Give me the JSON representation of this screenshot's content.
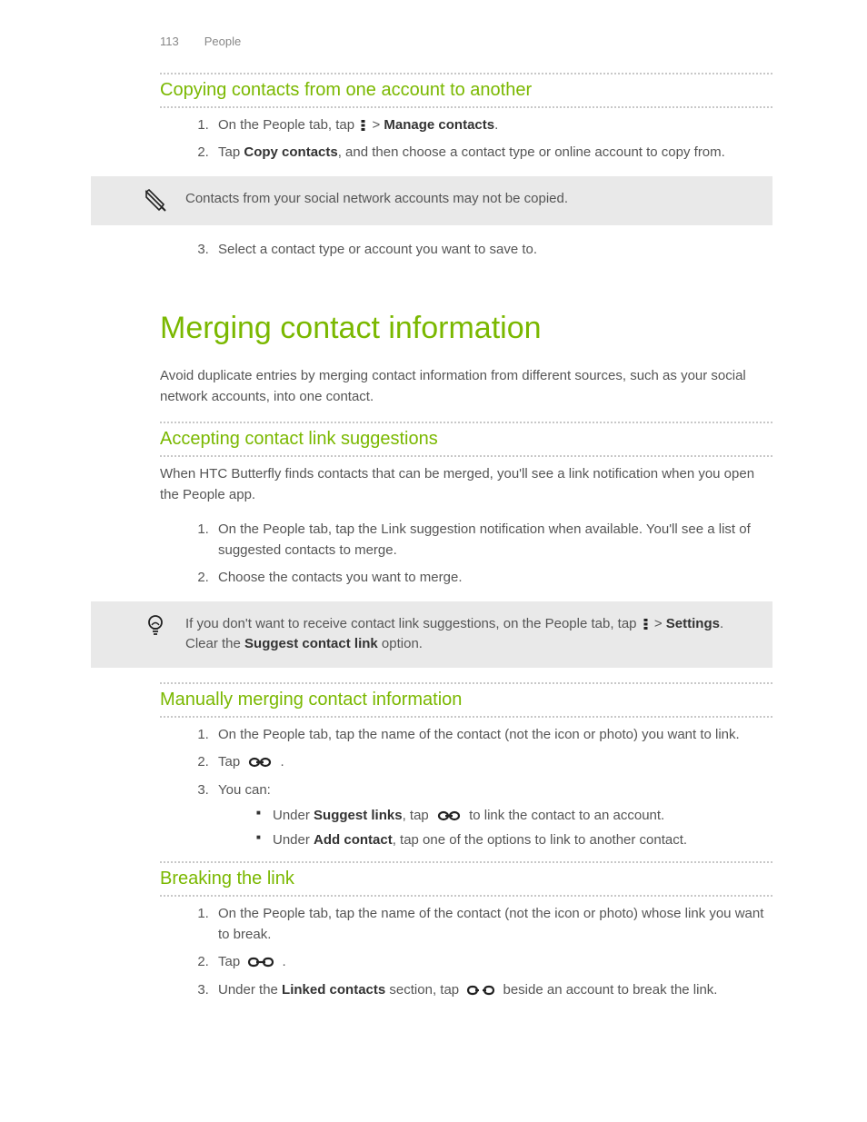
{
  "header": {
    "page_number": "113",
    "section": "People"
  },
  "copy_section": {
    "heading": "Copying contacts from one account to another",
    "step1_before": "On the People tab, tap ",
    "step1_after": " > ",
    "step1_bold": "Manage contacts",
    "step1_end": ".",
    "step2_before": "Tap ",
    "step2_bold": "Copy contacts",
    "step2_after": ", and then choose a contact type or online account to copy from.",
    "note": "Contacts from your social network accounts may not be copied.",
    "step3": "Select a contact type or account you want to save to."
  },
  "merge_section": {
    "heading": "Merging contact information",
    "intro": "Avoid duplicate entries by merging contact information from different sources, such as your social network accounts, into one contact."
  },
  "accept_section": {
    "heading": "Accepting contact link suggestions",
    "intro": "When HTC Butterfly finds contacts that can be merged, you'll see a link notification when you open the People app.",
    "step1": "On the People tab, tap the Link suggestion notification when available. You'll see a list of suggested contacts to merge.",
    "step2": "Choose the contacts you want to merge.",
    "tip_before": "If you don't want to receive contact link suggestions, on the People tab, tap ",
    "tip_after": " > ",
    "tip_bold1": "Settings",
    "tip_mid": ". Clear the ",
    "tip_bold2": "Suggest contact link",
    "tip_end": " option."
  },
  "manual_section": {
    "heading": "Manually merging contact information",
    "step1": "On the People tab, tap the name of the contact (not the icon or photo) you want to link.",
    "step2_before": "Tap ",
    "step2_after": " .",
    "step3": "You can:",
    "bullet1_before": "Under ",
    "bullet1_bold": "Suggest links",
    "bullet1_mid": ", tap ",
    "bullet1_after": " to link the contact to an account.",
    "bullet2_before": "Under ",
    "bullet2_bold": "Add contact",
    "bullet2_after": ", tap one of the options to link to another contact."
  },
  "break_section": {
    "heading": "Breaking the link",
    "step1": "On the People tab, tap the name of the contact (not the icon or photo) whose link you want to break.",
    "step2_before": "Tap ",
    "step2_after": " .",
    "step3_before": "Under the ",
    "step3_bold": "Linked contacts",
    "step3_mid": " section, tap ",
    "step3_after": " beside an account to break the link."
  }
}
